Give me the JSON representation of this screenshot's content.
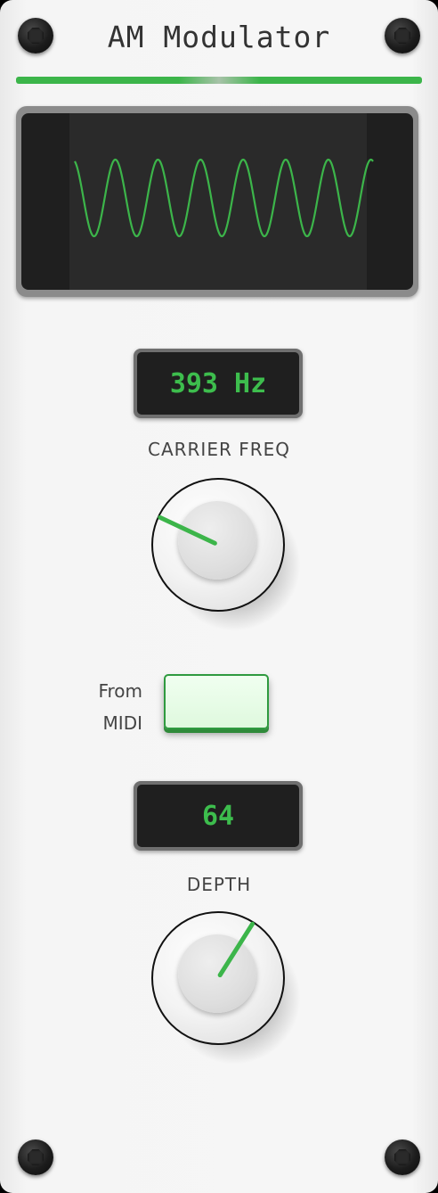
{
  "module": {
    "title": "AM Modulator",
    "accent_color": "#3cb54a"
  },
  "scope": {
    "trace_color": "#3cb54a",
    "cycles": 7
  },
  "carrier": {
    "display": "393 Hz",
    "label": "CARRIER FREQ",
    "knob_value": 0.26
  },
  "midi_toggle": {
    "label_line1": "From",
    "label_line2": "MIDI",
    "active": true
  },
  "depth": {
    "display": "64",
    "label": "DEPTH",
    "knob_value": 0.62
  }
}
